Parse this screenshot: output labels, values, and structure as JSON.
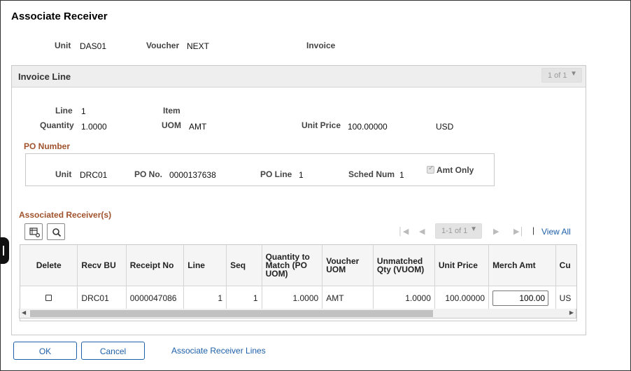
{
  "dialog": {
    "title": "Associate Receiver"
  },
  "header": {
    "unit_label": "Unit",
    "unit_value": "DAS01",
    "voucher_label": "Voucher",
    "voucher_value": "NEXT",
    "invoice_label": "Invoice"
  },
  "invoice_line": {
    "title": "Invoice Line",
    "pager": "1 of 1",
    "line_label": "Line",
    "line_value": "1",
    "item_label": "Item",
    "quantity_label": "Quantity",
    "quantity_value": "1.0000",
    "uom_label": "UOM",
    "uom_value": "AMT",
    "unit_price_label": "Unit Price",
    "unit_price_value": "100.00000",
    "currency": "USD"
  },
  "po": {
    "title": "PO Number",
    "unit_label": "Unit",
    "unit_value": "DRC01",
    "po_no_label": "PO No.",
    "po_no_value": "0000137638",
    "po_line_label": "PO Line",
    "po_line_value": "1",
    "sched_label": "Sched Num",
    "sched_value": "1",
    "amt_only_label": "Amt Only",
    "amt_only_checked": true
  },
  "receivers": {
    "title": "Associated Receiver(s)",
    "pager": "1-1 of 1",
    "view_all": "View All",
    "columns": [
      "Delete",
      "Recv BU",
      "Receipt No",
      "Line",
      "Seq",
      "Quantity to Match (PO UOM)",
      "Voucher UOM",
      "Unmatched Qty (VUOM)",
      "Unit Price",
      "Merch Amt",
      "Cu"
    ],
    "rows": [
      {
        "recv_bu": "DRC01",
        "receipt_no": "0000047086",
        "line": "1",
        "seq": "1",
        "qty_match": "1.0000",
        "voucher_uom": "AMT",
        "unmatched_qty": "1.0000",
        "unit_price": "100.00000",
        "merch_amt": "100.00",
        "currency": "US"
      }
    ]
  },
  "footer": {
    "ok_label": "OK",
    "cancel_label": "Cancel",
    "link_label": "Associate Receiver Lines"
  },
  "colors": {
    "accent": "#1d5fa8",
    "section_title": "#a0522d"
  }
}
